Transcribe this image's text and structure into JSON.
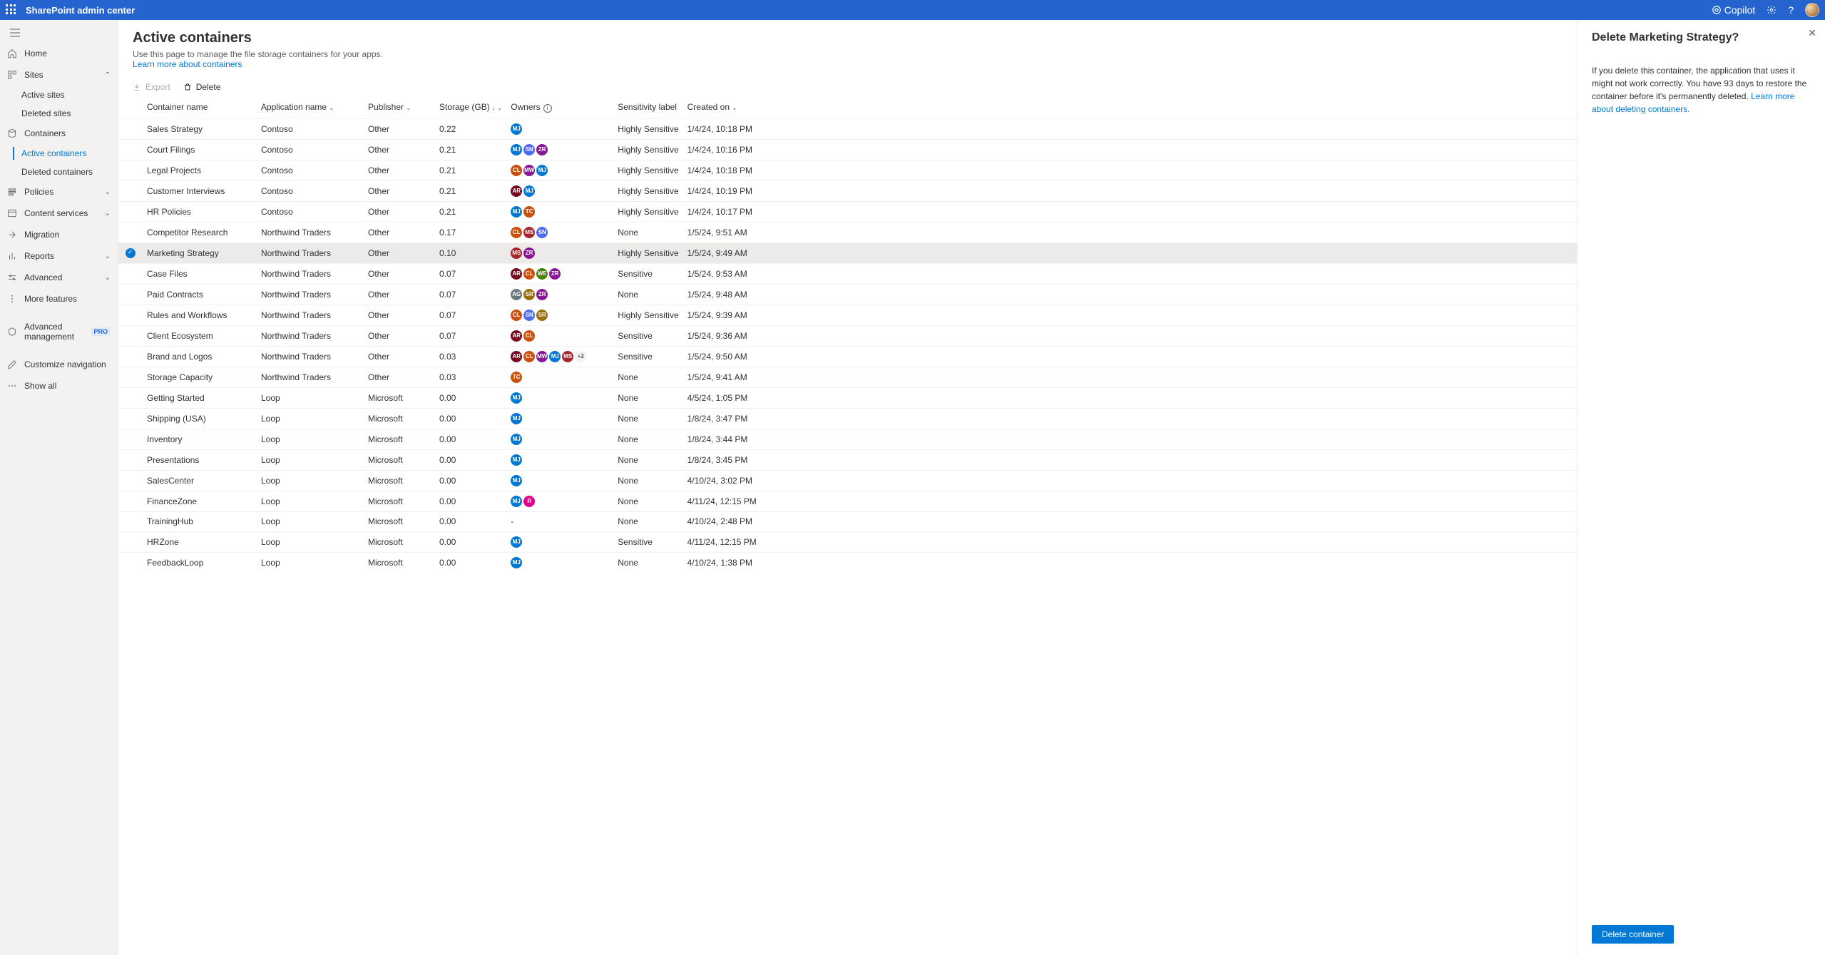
{
  "top": {
    "title": "SharePoint admin center",
    "copilot": "Copilot"
  },
  "nav": {
    "home": "Home",
    "sites": "Sites",
    "activeSites": "Active sites",
    "deletedSites": "Deleted sites",
    "containers": "Containers",
    "activeContainers": "Active containers",
    "deletedContainers": "Deleted containers",
    "policies": "Policies",
    "contentServices": "Content services",
    "migration": "Migration",
    "reports": "Reports",
    "advanced": "Advanced",
    "moreFeatures": "More features",
    "advancedManagement": "Advanced management",
    "proBadge": "PRO",
    "customizeNavigation": "Customize navigation",
    "showAll": "Show all"
  },
  "page": {
    "title": "Active containers",
    "desc": "Use this page to manage the file storage containers for your apps.",
    "learnMore": "Learn more about containers"
  },
  "commands": {
    "export": "Export",
    "delete": "Delete"
  },
  "columns": {
    "containerName": "Container name",
    "applicationName": "Application name",
    "publisher": "Publisher",
    "storage": "Storage (GB)",
    "owners": "Owners",
    "sensitivity": "Sensitivity label",
    "createdOn": "Created on"
  },
  "rows": [
    {
      "name": "Sales Strategy",
      "app": "Contoso",
      "pub": "Other",
      "storage": "0.22",
      "owners": [
        {
          "i": "MJ",
          "c": "#0078d4"
        }
      ],
      "sens": "Highly Sensitive",
      "created": "1/4/24, 10:18 PM",
      "sel": false
    },
    {
      "name": "Court Filings",
      "app": "Contoso",
      "pub": "Other",
      "storage": "0.21",
      "owners": [
        {
          "i": "MJ",
          "c": "#0078d4"
        },
        {
          "i": "SN",
          "c": "#4f6bed"
        },
        {
          "i": "ZR",
          "c": "#881798"
        }
      ],
      "sens": "Highly Sensitive",
      "created": "1/4/24, 10:16 PM",
      "sel": false
    },
    {
      "name": "Legal Projects",
      "app": "Contoso",
      "pub": "Other",
      "storage": "0.21",
      "owners": [
        {
          "i": "CL",
          "c": "#ca5010"
        },
        {
          "i": "MW",
          "c": "#881798"
        },
        {
          "i": "MJ",
          "c": "#0078d4"
        }
      ],
      "sens": "Highly Sensitive",
      "created": "1/4/24, 10:18 PM",
      "sel": false
    },
    {
      "name": "Customer Interviews",
      "app": "Contoso",
      "pub": "Other",
      "storage": "0.21",
      "owners": [
        {
          "i": "AR",
          "c": "#750b1c"
        },
        {
          "i": "MJ",
          "c": "#0078d4"
        }
      ],
      "sens": "Highly Sensitive",
      "created": "1/4/24, 10:19 PM",
      "sel": false
    },
    {
      "name": "HR Policies",
      "app": "Contoso",
      "pub": "Other",
      "storage": "0.21",
      "owners": [
        {
          "i": "MJ",
          "c": "#0078d4"
        },
        {
          "i": "TC",
          "c": "#ca5010"
        }
      ],
      "sens": "Highly Sensitive",
      "created": "1/4/24, 10:17 PM",
      "sel": false
    },
    {
      "name": "Competitor Research",
      "app": "Northwind Traders",
      "pub": "Other",
      "storage": "0.17",
      "owners": [
        {
          "i": "CL",
          "c": "#ca5010"
        },
        {
          "i": "MS",
          "c": "#a4262c"
        },
        {
          "i": "SN",
          "c": "#4f6bed"
        }
      ],
      "sens": "None",
      "created": "1/5/24, 9:51 AM",
      "sel": false
    },
    {
      "name": "Marketing Strategy",
      "app": "Northwind Traders",
      "pub": "Other",
      "storage": "0.10",
      "owners": [
        {
          "i": "MS",
          "c": "#a4262c"
        },
        {
          "i": "ZR",
          "c": "#881798"
        }
      ],
      "sens": "Highly Sensitive",
      "created": "1/5/24, 9:49 AM",
      "sel": true
    },
    {
      "name": "Case Files",
      "app": "Northwind Traders",
      "pub": "Other",
      "storage": "0.07",
      "owners": [
        {
          "i": "AR",
          "c": "#750b1c"
        },
        {
          "i": "CL",
          "c": "#ca5010"
        },
        {
          "i": "WE",
          "c": "#498205"
        },
        {
          "i": "ZR",
          "c": "#881798"
        }
      ],
      "sens": "Sensitive",
      "created": "1/5/24, 9:53 AM",
      "sel": false
    },
    {
      "name": "Paid Contracts",
      "app": "Northwind Traders",
      "pub": "Other",
      "storage": "0.07",
      "owners": [
        {
          "i": "AG",
          "c": "#69797e"
        },
        {
          "i": "SR",
          "c": "#986f0b"
        },
        {
          "i": "ZR",
          "c": "#881798"
        }
      ],
      "sens": "None",
      "created": "1/5/24, 9:48 AM",
      "sel": false
    },
    {
      "name": "Rules and Workflows",
      "app": "Northwind Traders",
      "pub": "Other",
      "storage": "0.07",
      "owners": [
        {
          "i": "CL",
          "c": "#ca5010"
        },
        {
          "i": "SN",
          "c": "#4f6bed"
        },
        {
          "i": "SR",
          "c": "#986f0b"
        }
      ],
      "sens": "Highly Sensitive",
      "created": "1/5/24, 9:39 AM",
      "sel": false
    },
    {
      "name": "Client Ecosystem",
      "app": "Northwind Traders",
      "pub": "Other",
      "storage": "0.07",
      "owners": [
        {
          "i": "AR",
          "c": "#750b1c"
        },
        {
          "i": "CL",
          "c": "#ca5010"
        }
      ],
      "sens": "Sensitive",
      "created": "1/5/24, 9:36 AM",
      "sel": false
    },
    {
      "name": "Brand and Logos",
      "app": "Northwind Traders",
      "pub": "Other",
      "storage": "0.03",
      "owners": [
        {
          "i": "AR",
          "c": "#750b1c"
        },
        {
          "i": "CL",
          "c": "#ca5010"
        },
        {
          "i": "MW",
          "c": "#881798"
        },
        {
          "i": "MJ",
          "c": "#0078d4"
        },
        {
          "i": "MS",
          "c": "#a4262c"
        }
      ],
      "extra": "+2",
      "sens": "Sensitive",
      "created": "1/5/24, 9:50 AM",
      "sel": false
    },
    {
      "name": "Storage Capacity",
      "app": "Northwind Traders",
      "pub": "Other",
      "storage": "0.03",
      "owners": [
        {
          "i": "TC",
          "c": "#ca5010"
        }
      ],
      "sens": "None",
      "created": "1/5/24, 9:41 AM",
      "sel": false
    },
    {
      "name": "Getting Started",
      "app": "Loop",
      "pub": "Microsoft",
      "storage": "0.00",
      "owners": [
        {
          "i": "MJ",
          "c": "#0078d4"
        }
      ],
      "sens": "None",
      "created": "4/5/24, 1:05 PM",
      "sel": false
    },
    {
      "name": "Shipping (USA)",
      "app": "Loop",
      "pub": "Microsoft",
      "storage": "0.00",
      "owners": [
        {
          "i": "MJ",
          "c": "#0078d4"
        }
      ],
      "sens": "None",
      "created": "1/8/24, 3:47 PM",
      "sel": false
    },
    {
      "name": "Inventory",
      "app": "Loop",
      "pub": "Microsoft",
      "storage": "0.00",
      "owners": [
        {
          "i": "MJ",
          "c": "#0078d4"
        }
      ],
      "sens": "None",
      "created": "1/8/24, 3:44 PM",
      "sel": false
    },
    {
      "name": "Presentations",
      "app": "Loop",
      "pub": "Microsoft",
      "storage": "0.00",
      "owners": [
        {
          "i": "MJ",
          "c": "#0078d4"
        }
      ],
      "sens": "None",
      "created": "1/8/24, 3:45 PM",
      "sel": false
    },
    {
      "name": "SalesCenter",
      "app": "Loop",
      "pub": "Microsoft",
      "storage": "0.00",
      "owners": [
        {
          "i": "MJ",
          "c": "#0078d4"
        }
      ],
      "sens": "None",
      "created": "4/10/24, 3:02 PM",
      "sel": false
    },
    {
      "name": "FinanceZone",
      "app": "Loop",
      "pub": "Microsoft",
      "storage": "0.00",
      "owners": [
        {
          "i": "MJ",
          "c": "#0078d4"
        },
        {
          "i": "R",
          "c": "#e3008c"
        }
      ],
      "sens": "None",
      "created": "4/11/24, 12:15 PM",
      "sel": false
    },
    {
      "name": "TrainingHub",
      "app": "Loop",
      "pub": "Microsoft",
      "storage": "0.00",
      "owners": [],
      "dash": "-",
      "sens": "None",
      "created": "4/10/24, 2:48 PM",
      "sel": false
    },
    {
      "name": "HRZone",
      "app": "Loop",
      "pub": "Microsoft",
      "storage": "0.00",
      "owners": [
        {
          "i": "MJ",
          "c": "#0078d4"
        }
      ],
      "sens": "Sensitive",
      "created": "4/11/24, 12:15 PM",
      "sel": false
    },
    {
      "name": "FeedbackLoop",
      "app": "Loop",
      "pub": "Microsoft",
      "storage": "0.00",
      "owners": [
        {
          "i": "MJ",
          "c": "#0078d4"
        }
      ],
      "sens": "None",
      "created": "4/10/24, 1:38 PM",
      "sel": false
    }
  ],
  "panel": {
    "title": "Delete Marketing Strategy?",
    "body1": "If you delete this container, the application that uses it might not work correctly. You have 93 days to restore the container before it's permanently deleted.",
    "learn": "Learn more about deleting containers.",
    "button": "Delete container"
  }
}
